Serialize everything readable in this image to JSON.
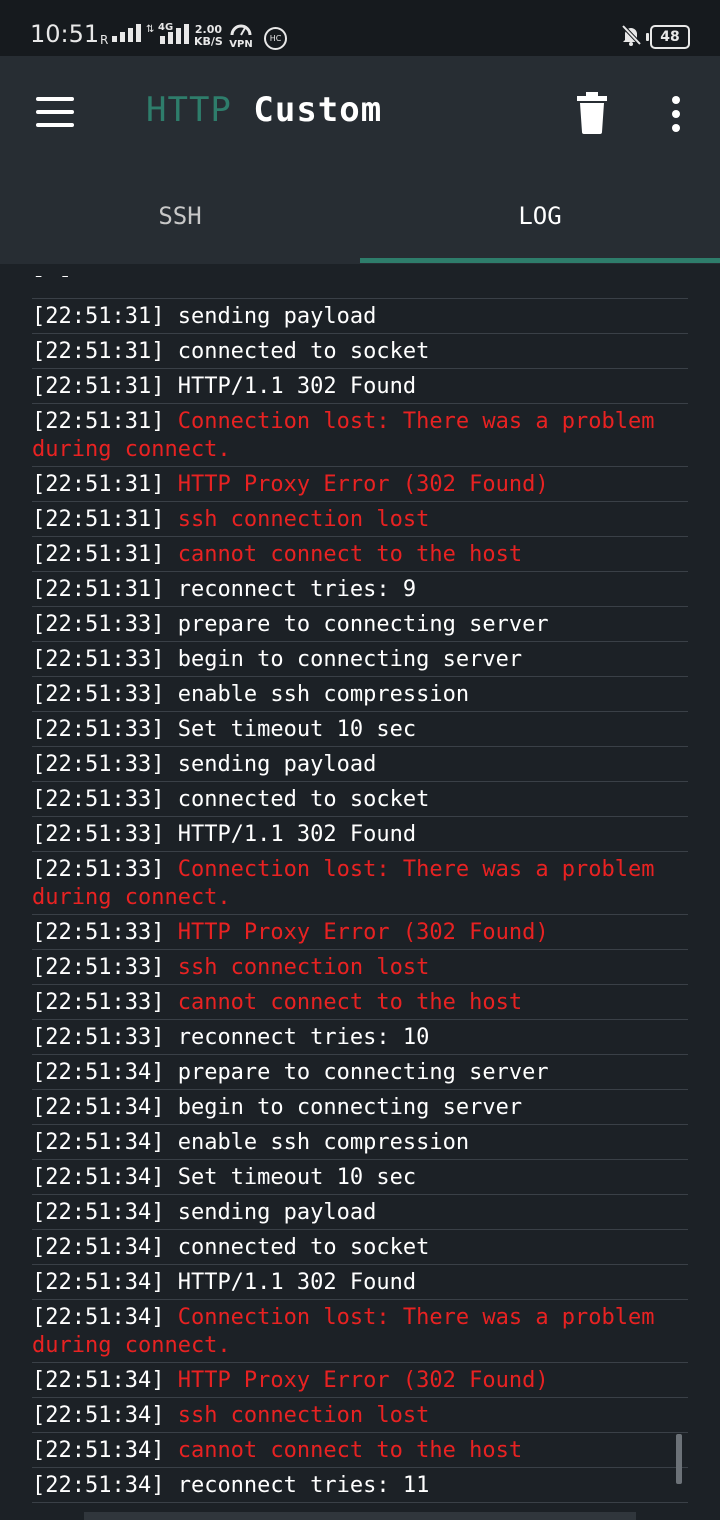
{
  "status_bar": {
    "time": "10:51",
    "network_r": "R",
    "network_4g": "4G",
    "speed_value": "2.00",
    "speed_unit": "KB/S",
    "vpn_label": "VPN",
    "hc_label": "HC",
    "battery": "48"
  },
  "app_bar": {
    "title_part1": "HTTP",
    "title_part2": "Custom"
  },
  "tabs": [
    {
      "label": "SSH",
      "selected": false
    },
    {
      "label": "LOG",
      "selected": true
    }
  ],
  "colors": {
    "accent": "#2e7d6b",
    "error": "#e82222",
    "background": "#1c2126",
    "appbar": "#272d33"
  },
  "log": [
    {
      "time": "[22:51:31]",
      "message": "sending payload",
      "error": false
    },
    {
      "time": "[22:51:31]",
      "message": "connected to socket",
      "error": false
    },
    {
      "time": "[22:51:31]",
      "message": "HTTP/1.1 302 Found",
      "error": false
    },
    {
      "time": "[22:51:31]",
      "message": "Connection lost: There was a problem during connect.",
      "error": true
    },
    {
      "time": "[22:51:31]",
      "message": "HTTP Proxy Error (302 Found)",
      "error": true
    },
    {
      "time": "[22:51:31]",
      "message": "ssh connection lost",
      "error": true
    },
    {
      "time": "[22:51:31]",
      "message": "cannot connect to the host",
      "error": true
    },
    {
      "time": "[22:51:31]",
      "message": "reconnect tries: 9",
      "error": false
    },
    {
      "time": "[22:51:33]",
      "message": "prepare to connecting server",
      "error": false
    },
    {
      "time": "[22:51:33]",
      "message": "begin to connecting server",
      "error": false
    },
    {
      "time": "[22:51:33]",
      "message": "enable ssh compression",
      "error": false
    },
    {
      "time": "[22:51:33]",
      "message": "Set timeout 10 sec",
      "error": false
    },
    {
      "time": "[22:51:33]",
      "message": "sending payload",
      "error": false
    },
    {
      "time": "[22:51:33]",
      "message": "connected to socket",
      "error": false
    },
    {
      "time": "[22:51:33]",
      "message": "HTTP/1.1 302 Found",
      "error": false
    },
    {
      "time": "[22:51:33]",
      "message": "Connection lost: There was a problem during connect.",
      "error": true
    },
    {
      "time": "[22:51:33]",
      "message": "HTTP Proxy Error (302 Found)",
      "error": true
    },
    {
      "time": "[22:51:33]",
      "message": "ssh connection lost",
      "error": true
    },
    {
      "time": "[22:51:33]",
      "message": "cannot connect to the host",
      "error": true
    },
    {
      "time": "[22:51:33]",
      "message": "reconnect tries: 10",
      "error": false
    },
    {
      "time": "[22:51:34]",
      "message": "prepare to connecting server",
      "error": false
    },
    {
      "time": "[22:51:34]",
      "message": "begin to connecting server",
      "error": false
    },
    {
      "time": "[22:51:34]",
      "message": "enable ssh compression",
      "error": false
    },
    {
      "time": "[22:51:34]",
      "message": "Set timeout 10 sec",
      "error": false
    },
    {
      "time": "[22:51:34]",
      "message": "sending payload",
      "error": false
    },
    {
      "time": "[22:51:34]",
      "message": "connected to socket",
      "error": false
    },
    {
      "time": "[22:51:34]",
      "message": "HTTP/1.1 302 Found",
      "error": false
    },
    {
      "time": "[22:51:34]",
      "message": "Connection lost: There was a problem during connect.",
      "error": true
    },
    {
      "time": "[22:51:34]",
      "message": "HTTP Proxy Error (302 Found)",
      "error": true
    },
    {
      "time": "[22:51:34]",
      "message": "ssh connection lost",
      "error": true
    },
    {
      "time": "[22:51:34]",
      "message": "cannot connect to the host",
      "error": true
    },
    {
      "time": "[22:51:34]",
      "message": "reconnect tries: 11",
      "error": false
    }
  ]
}
